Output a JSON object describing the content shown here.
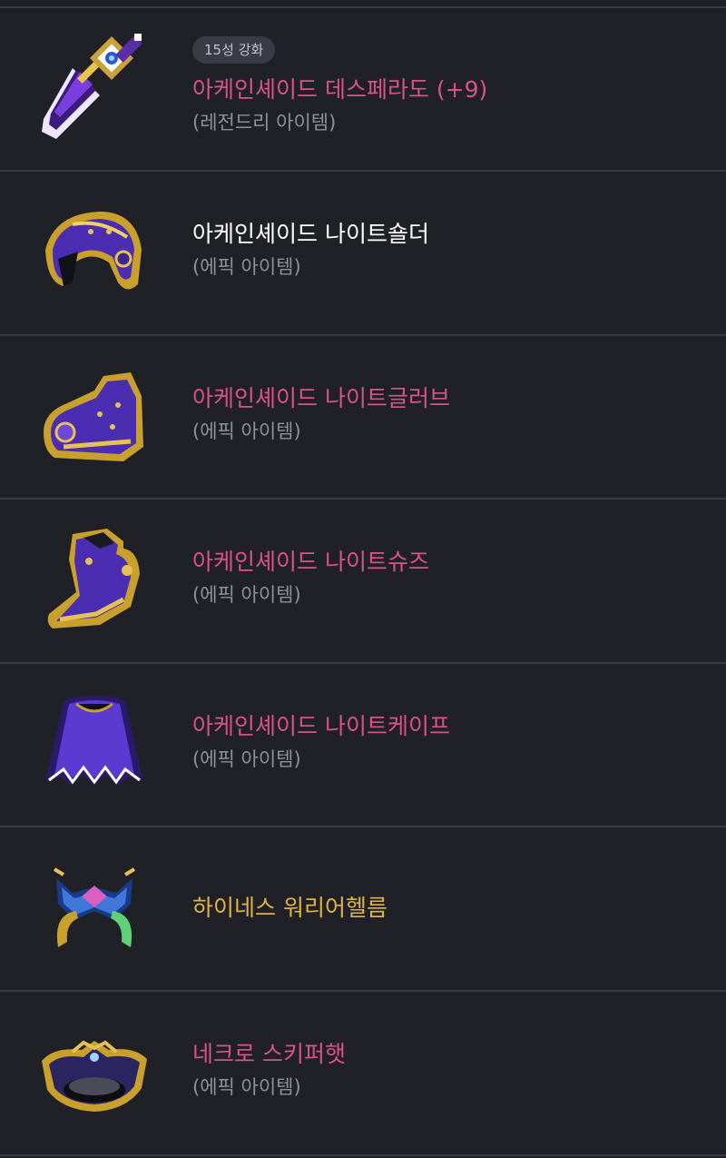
{
  "items": [
    {
      "badge": "15성 강화",
      "name": "아케인셰이드 데스페라도 (+9)",
      "grade": "(레전드리 아이템)",
      "name_color": "#d9528a",
      "icon": "arcane-desperado-weapon-icon"
    },
    {
      "name": "아케인셰이드 나이트숄더",
      "grade": "(에픽 아이템)",
      "name_color": "#ffffff",
      "icon": "arcane-night-shoulder-icon"
    },
    {
      "name": "아케인셰이드 나이트글러브",
      "grade": "(에픽 아이템)",
      "name_color": "#d9528a",
      "icon": "arcane-night-glove-icon"
    },
    {
      "name": "아케인셰이드 나이트슈즈",
      "grade": "(에픽 아이템)",
      "name_color": "#d9528a",
      "icon": "arcane-night-shoes-icon"
    },
    {
      "name": "아케인셰이드 나이트케이프",
      "grade": "(에픽 아이템)",
      "name_color": "#d9528a",
      "icon": "arcane-night-cape-icon"
    },
    {
      "name": "하이네스 워리어헬름",
      "name_color": "#e0b343",
      "icon": "highness-warrior-helm-icon"
    },
    {
      "name": "네크로 스키퍼햇",
      "grade": "(에픽 아이템)",
      "name_color": "#d9528a",
      "icon": "necro-skipper-hat-icon"
    }
  ]
}
